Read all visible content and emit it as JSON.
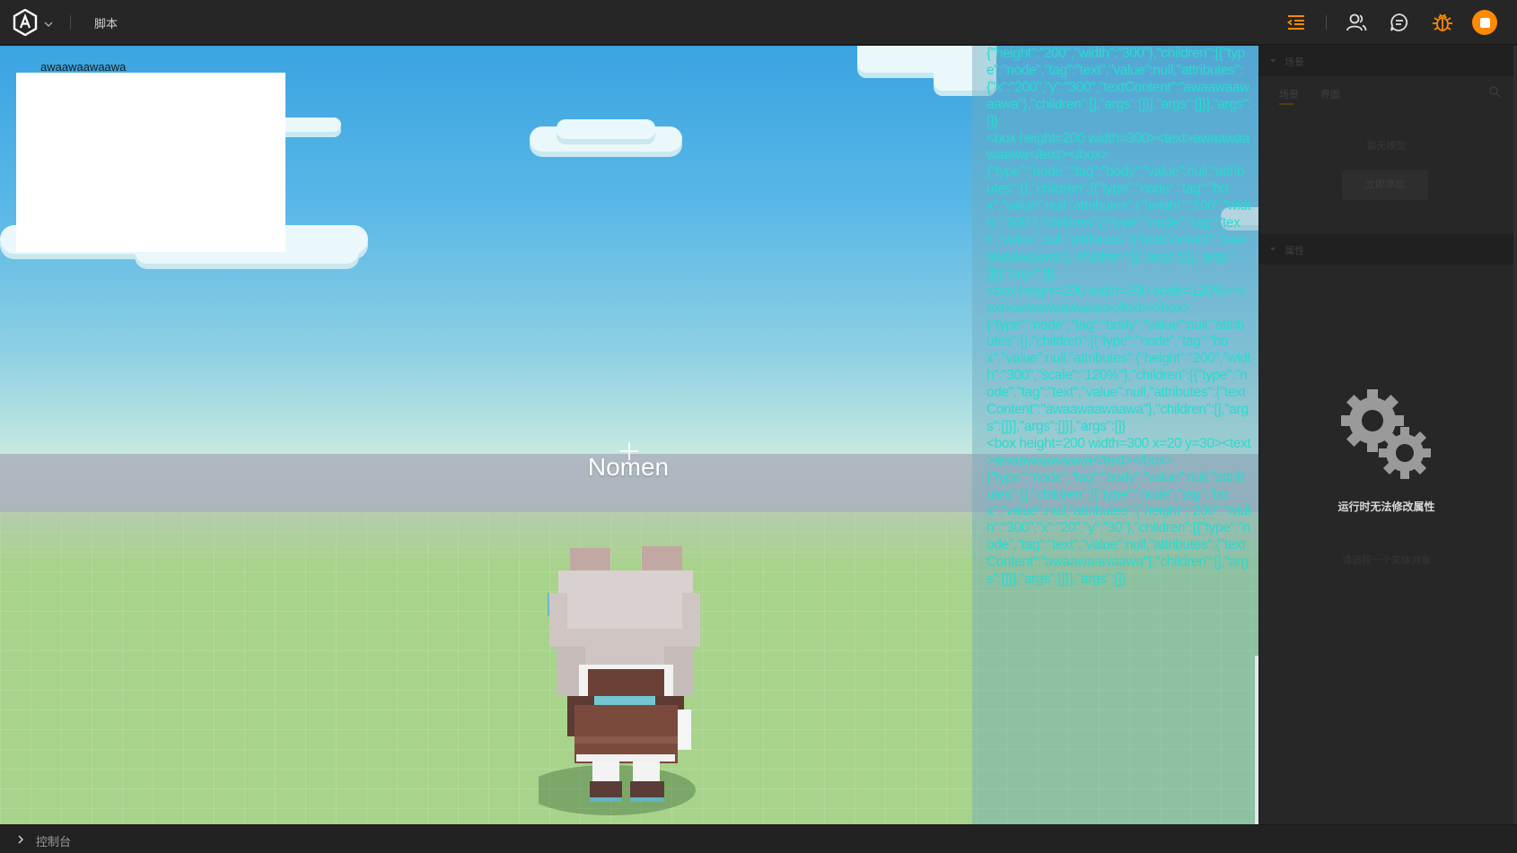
{
  "topbar": {
    "title": "脚本",
    "icons": [
      "app-logo-icon",
      "chevron-down-icon",
      "list-indent-icon",
      "users-icon",
      "chat-icon",
      "bug-icon",
      "stop-icon"
    ],
    "accent_color": "#ff8a00"
  },
  "viewport": {
    "ui_text": "awaawaawaawa",
    "nametag": "Nomen"
  },
  "log": {
    "lines": [
      "{\"height\":\"200\",\"width\":\"300\"},\"children\":[{\"type\":\"node\",\"tag\":\"text\",\"value\":null,\"attributes\":{\"x\":\"200\",\"y\":\"300\",\"textContent\":\"awaawaawaawa\"},\"children\":[],\"args\":[]}],\"args\":[]}],\"args\":[]}",
      "<box height=200 width=300><text>awaawaawaawa</text></box>",
      "{\"type\":\"node\",\"tag\":\"body\",\"value\":null,\"attributes\":{},\"children\":[{\"type\":\"node\",\"tag\":\"box\",\"value\":null,\"attributes\":{\"height\":\"200\",\"width\":\"300\"},\"children\":[{\"type\":\"node\",\"tag\":\"text\",\"value\":null,\"attributes\":{\"textContent\":\"awaawaawaawa\"},\"children\":[],\"args\":[]}],\"args\":[]}],\"args\":[]}",
      "<box height=200 width=300 scale=120%><text>awaawaawaawa</text></box>",
      "{\"type\":\"node\",\"tag\":\"body\",\"value\":null,\"attributes\":{},\"children\":[{\"type\":\"node\",\"tag\":\"box\",\"value\":null,\"attributes\":{\"height\":\"200\",\"width\":\"300\",\"scale\":\"120%\"},\"children\":[{\"type\":\"node\",\"tag\":\"text\",\"value\":null,\"attributes\":{\"textContent\":\"awaawaawaawa\"},\"children\":[],\"args\":[]}],\"args\":[]}],\"args\":[]}",
      "<box height=200 width=300 x=20 y=30><text>awaawaawaawa</text></box>",
      "{\"type\":\"node\",\"tag\":\"body\",\"value\":null,\"attributes\":{},\"children\":[{\"type\":\"node\",\"tag\":\"box\",\"value\":null,\"attributes\":{\"height\":\"200\",\"width\":\"300\",\"x\":\"20\",\"y\":\"30\"},\"children\":[{\"type\":\"node\",\"tag\":\"text\",\"value\":null,\"attributes\":{\"textContent\":\"awaawaawaawa\"},\"children\":[],\"args\":[]}],\"args\":[]}],\"args\":[]}"
    ],
    "text_color": "#27dbd0"
  },
  "right_panel": {
    "section1_label": "场景",
    "tab1": "场景",
    "tab2": "界面",
    "empty_text": "暂无模型",
    "add_button": "立即添加",
    "section2_label": "属性",
    "running_notice": "运行时无法修改属性",
    "faint_hint": "请选择一个实体对象"
  },
  "bottombar": {
    "console_label": "控制台"
  }
}
